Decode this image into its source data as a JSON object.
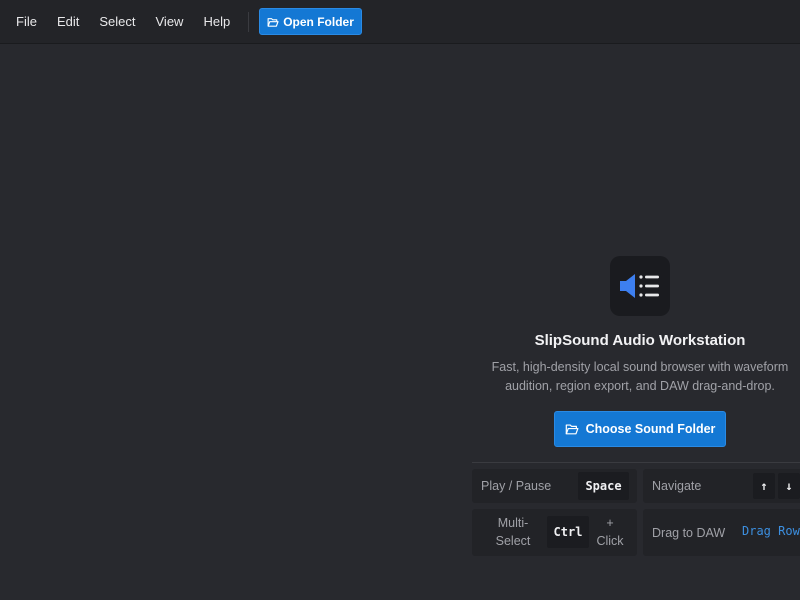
{
  "menubar": {
    "items": [
      "File",
      "Edit",
      "Select",
      "View",
      "Help"
    ],
    "open_folder_label": "Open Folder"
  },
  "welcome": {
    "icon": "speaker-list-icon",
    "title": "SlipSound Audio Workstation",
    "description_line1": "Fast, high-density local sound browser with waveform",
    "description_line2": "audition, region export, and DAW drag-and-drop.",
    "choose_button_label": "Choose Sound Folder"
  },
  "shortcuts": {
    "play": {
      "label": "Play / Pause",
      "key": "Space"
    },
    "navigate": {
      "label": "Navigate",
      "key_up": "↑",
      "key_down": "↓"
    },
    "multi": {
      "label_line1": "Multi-",
      "label_line2": "Select",
      "key": "Ctrl",
      "suffix_line1": "+",
      "suffix_line2": "Click"
    },
    "drag": {
      "label": "Drag to DAW",
      "hint": "Drag Row"
    }
  },
  "colors": {
    "accent": "#1478d4",
    "background": "#28292e",
    "menubar": "#232428",
    "icon_blue": "#3d7ff0"
  }
}
